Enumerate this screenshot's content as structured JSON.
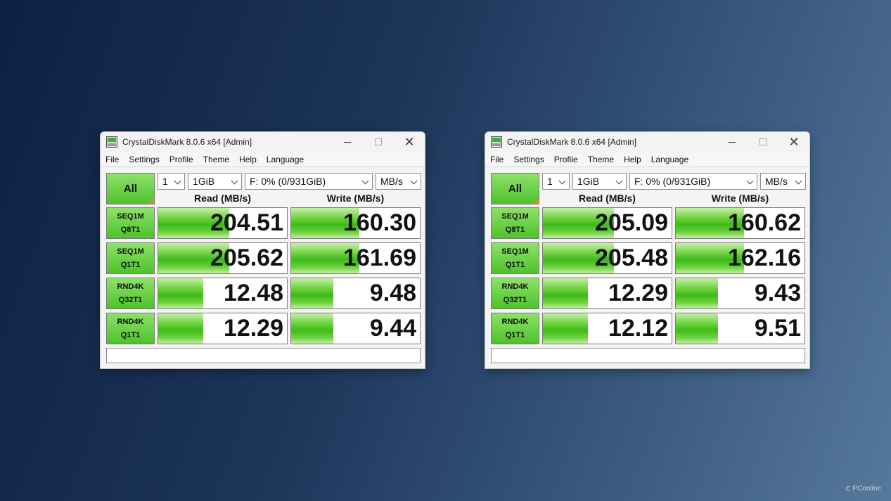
{
  "windows": [
    {
      "title": "CrystalDiskMark 8.0.6 x64 [Admin]",
      "menu": [
        "File",
        "Settings",
        "Profile",
        "Theme",
        "Help",
        "Language"
      ],
      "all_label": "All",
      "selects": {
        "count": "1",
        "size": "1GiB",
        "drive": "F: 0% (0/931GiB)",
        "unit": "MB/s"
      },
      "read_header": "Read (MB/s)",
      "write_header": "Write (MB/s)",
      "tests": [
        {
          "line1": "SEQ1M",
          "line2": "Q8T1",
          "read": "204.51",
          "write": "160.30",
          "read_fill": 0.55,
          "write_fill": 0.53
        },
        {
          "line1": "SEQ1M",
          "line2": "Q1T1",
          "read": "205.62",
          "write": "161.69",
          "read_fill": 0.55,
          "write_fill": 0.53
        },
        {
          "line1": "RND4K",
          "line2": "Q32T1",
          "read": "12.48",
          "write": "9.48",
          "read_fill": 0.35,
          "write_fill": 0.33
        },
        {
          "line1": "RND4K",
          "line2": "Q1T1",
          "read": "12.29",
          "write": "9.44",
          "read_fill": 0.35,
          "write_fill": 0.33
        }
      ],
      "status": ""
    },
    {
      "title": "CrystalDiskMark 8.0.6 x64 [Admin]",
      "menu": [
        "File",
        "Settings",
        "Profile",
        "Theme",
        "Help",
        "Language"
      ],
      "all_label": "All",
      "selects": {
        "count": "1",
        "size": "1GiB",
        "drive": "F: 0% (0/931GiB)",
        "unit": "MB/s"
      },
      "read_header": "Read (MB/s)",
      "write_header": "Write (MB/s)",
      "tests": [
        {
          "line1": "SEQ1M",
          "line2": "Q8T1",
          "read": "205.09",
          "write": "160.62",
          "read_fill": 0.55,
          "write_fill": 0.53
        },
        {
          "line1": "SEQ1M",
          "line2": "Q1T1",
          "read": "205.48",
          "write": "162.16",
          "read_fill": 0.55,
          "write_fill": 0.53
        },
        {
          "line1": "RND4K",
          "line2": "Q32T1",
          "read": "12.29",
          "write": "9.43",
          "read_fill": 0.35,
          "write_fill": 0.33
        },
        {
          "line1": "RND4K",
          "line2": "Q1T1",
          "read": "12.12",
          "write": "9.51",
          "read_fill": 0.35,
          "write_fill": 0.33
        }
      ],
      "status": ""
    }
  ],
  "watermark": "PConline"
}
